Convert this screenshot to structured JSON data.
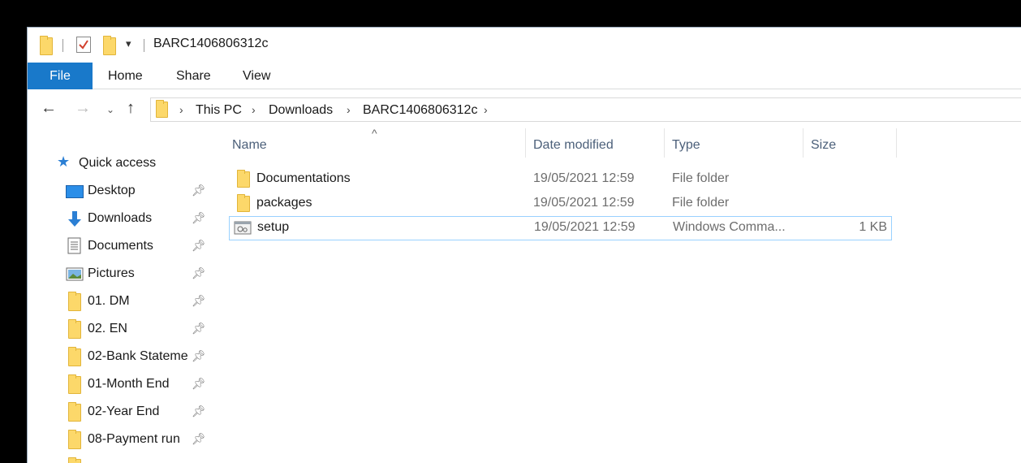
{
  "window": {
    "title": "BARC1406806312c"
  },
  "ribbon": {
    "tabs": [
      "File",
      "Home",
      "Share",
      "View"
    ]
  },
  "address": {
    "crumbs": [
      "This PC",
      "Downloads",
      "BARC1406806312c"
    ]
  },
  "nav": {
    "quick_access_label": "Quick access",
    "items": [
      {
        "label": "Desktop",
        "icon": "desktop-icon"
      },
      {
        "label": "Downloads",
        "icon": "download-arrow-icon"
      },
      {
        "label": "Documents",
        "icon": "document-icon"
      },
      {
        "label": "Pictures",
        "icon": "pictures-icon"
      },
      {
        "label": "01. DM",
        "icon": "folder-icon"
      },
      {
        "label": "02. EN",
        "icon": "folder-icon"
      },
      {
        "label": "02-Bank Stateme",
        "icon": "folder-icon"
      },
      {
        "label": "01-Month End",
        "icon": "folder-icon"
      },
      {
        "label": "02-Year End",
        "icon": "folder-icon"
      },
      {
        "label": "08-Payment run",
        "icon": "folder-icon"
      }
    ]
  },
  "columns": {
    "name": "Name",
    "date": "Date modified",
    "type": "Type",
    "size": "Size"
  },
  "files": [
    {
      "name": "Documentations",
      "date": "19/05/2021 12:59",
      "type": "File folder",
      "size": "",
      "icon": "folder-icon"
    },
    {
      "name": "packages",
      "date": "19/05/2021 12:59",
      "type": "File folder",
      "size": "",
      "icon": "folder-icon"
    },
    {
      "name": "setup",
      "date": "19/05/2021 12:59",
      "type": "Windows Comma...",
      "size": "1 KB",
      "icon": "batch-script-icon"
    }
  ],
  "colors": {
    "file_tab": "#1979ca",
    "folder": "#fcd86a",
    "selection_border": "#99d1ff"
  }
}
